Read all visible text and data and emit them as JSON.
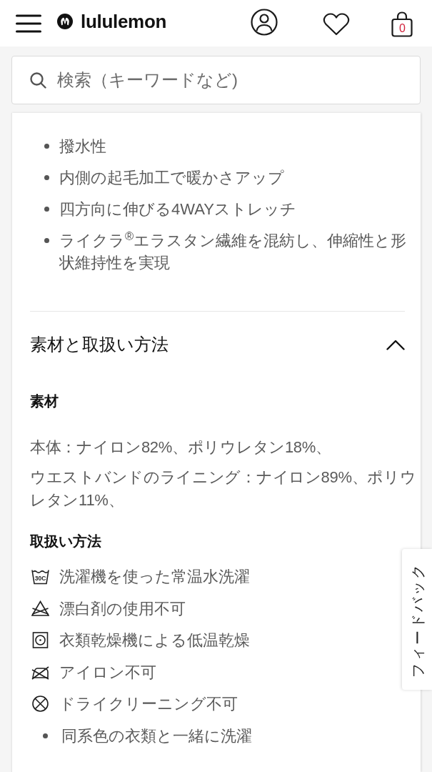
{
  "header": {
    "logo": "lululemon",
    "cart_count": "0"
  },
  "search": {
    "placeholder": "検索（キーワードなど)"
  },
  "features": [
    "撥水性",
    "内側の起毛加工で暖かさアップ",
    "四方向に伸びる4WAYストレッチ",
    "ライクラ$^{®}$エラスタン繊維を混紡し、伸縮性と形状維持性を実現"
  ],
  "section": {
    "title": "素材と取扱い方法",
    "expanded": true,
    "materials": {
      "heading": "素材",
      "lines": [
        "本体：ナイロン82%、ポリウレタン18%、",
        "ウエストバンドのライニング：ナイロン89%、ポリウレタン11%、"
      ]
    },
    "care": {
      "heading": "取扱い方法",
      "items": [
        {
          "kind": "wash",
          "label": "30C",
          "text": "洗濯機を使った常温水洗濯"
        },
        {
          "kind": "no-bleach",
          "text": "漂白剤の使用不可"
        },
        {
          "kind": "tumble-dry",
          "text": "衣類乾燥機による低温乾燥"
        },
        {
          "kind": "no-iron",
          "text": "アイロン不可"
        },
        {
          "kind": "no-dryclean",
          "text": "ドライクリーニング不可"
        },
        {
          "kind": "bullet",
          "text": "同系色の衣類と一緒に洗濯"
        }
      ]
    }
  },
  "feedback": {
    "label": "フィードバック"
  }
}
